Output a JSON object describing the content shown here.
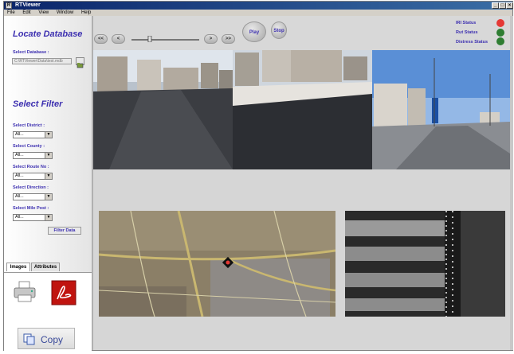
{
  "window": {
    "title": "RTViewer",
    "menu": [
      "File",
      "Edit",
      "View",
      "Window",
      "Help"
    ],
    "controls": [
      "_",
      "□",
      "×"
    ]
  },
  "left_panel": {
    "locate_heading": "Locate Database",
    "select_database_label": "Select Database :",
    "database_path": "C:\\RTViewer\\Data\\test.mdb",
    "filter_heading": "Select Filter",
    "filters": [
      {
        "label": "Select District :",
        "value": "All..."
      },
      {
        "label": "Select County :",
        "value": "All..."
      },
      {
        "label": "Select Route No :",
        "value": "All..."
      },
      {
        "label": "Select Direction :",
        "value": "All..."
      },
      {
        "label": "Select Mile Post :",
        "value": "All..."
      }
    ],
    "filter_button": "Filter Data",
    "tabs": [
      "Images",
      "Attributes"
    ],
    "copy_button": "Copy"
  },
  "toolbar": {
    "first": "<<",
    "prev": "<",
    "next": ">",
    "last": ">>",
    "play": "Play",
    "stop": "Stop",
    "slider_position": 0.27
  },
  "status": [
    {
      "label": "IRI Status",
      "color": "#e53935"
    },
    {
      "label": "Rut Status",
      "color": "#2e7d32"
    },
    {
      "label": "Distress Status",
      "color": "#2e7d32"
    }
  ],
  "colors": {
    "heading": "#3c2fb0",
    "titlebar": "#0a246a"
  }
}
